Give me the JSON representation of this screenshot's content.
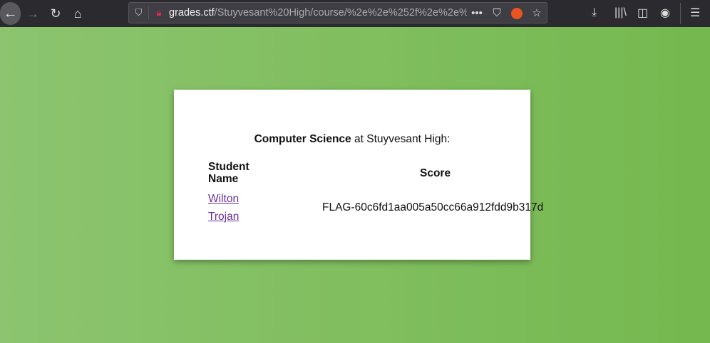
{
  "browser": {
    "url_host": "grades.ctf",
    "url_path": "/Stuyvesant%20High/course/%2e%2e%252f%2e%2e%252"
  },
  "heading": {
    "course": "Computer Science",
    "connector": " at ",
    "school": "Stuyvesant High:"
  },
  "table": {
    "headers": [
      "Student Name",
      "Score"
    ],
    "students": [
      "Wilton",
      "Trojan"
    ],
    "score": "FLAG-60c6fd1aa005a50cc66a912fdd9b317d"
  }
}
